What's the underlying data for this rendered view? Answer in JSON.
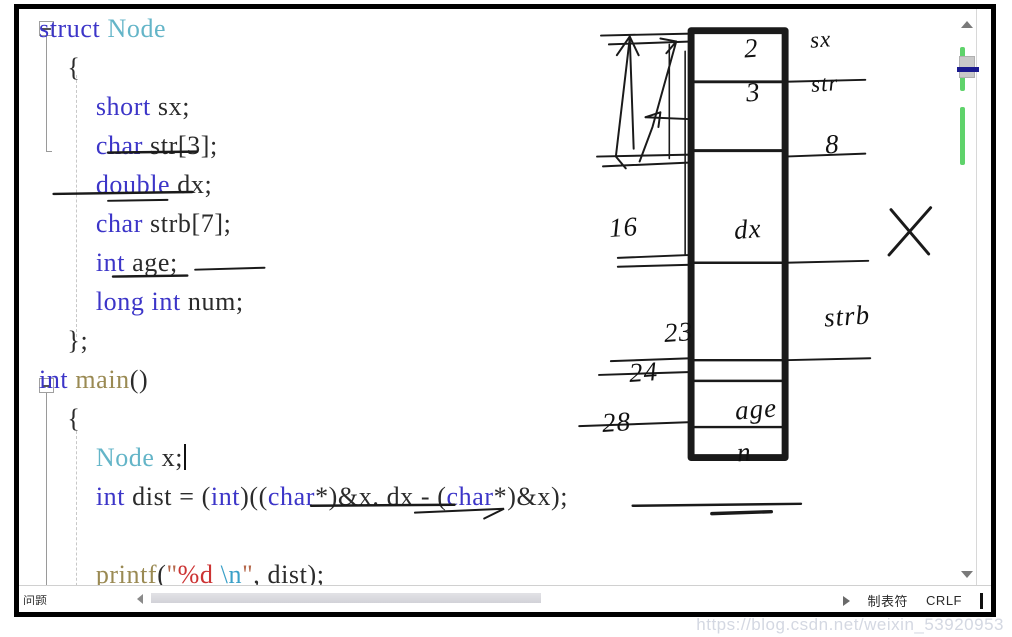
{
  "editor": {
    "language": "C++",
    "colors": {
      "keyword": "#3c35c8",
      "class": "#64b5c8",
      "function": "#9a8a53",
      "identifier": "#2b2b2b",
      "string": "#b5674a",
      "format_spec": "#cc3333",
      "escape": "#3aa0c8",
      "change_marker": "#5fd36b",
      "scroll_highlight": "#1b1b8f"
    },
    "code_lines": [
      {
        "id": "l1",
        "indent": 0,
        "fold": "open",
        "tokens": [
          {
            "t": "struct",
            "c": "kw"
          },
          {
            "t": " ",
            "c": "punc"
          },
          {
            "t": "Node",
            "c": "cls"
          }
        ]
      },
      {
        "id": "l2",
        "indent": 1,
        "tokens": [
          {
            "t": "{",
            "c": "punc"
          }
        ]
      },
      {
        "id": "l3",
        "indent": 2,
        "tokens": [
          {
            "t": "short",
            "c": "type"
          },
          {
            "t": " sx",
            "c": "id"
          },
          {
            "t": ";",
            "c": "punc"
          }
        ]
      },
      {
        "id": "l4",
        "indent": 2,
        "tokens": [
          {
            "t": "char",
            "c": "type"
          },
          {
            "t": " str",
            "c": "id"
          },
          {
            "t": "[",
            "c": "punc"
          },
          {
            "t": "3",
            "c": "num"
          },
          {
            "t": "]",
            "c": "punc"
          },
          {
            "t": ";",
            "c": "punc"
          }
        ]
      },
      {
        "id": "l5",
        "indent": 2,
        "tokens": [
          {
            "t": "double",
            "c": "type"
          },
          {
            "t": " dx",
            "c": "id"
          },
          {
            "t": ";",
            "c": "punc"
          }
        ]
      },
      {
        "id": "l6",
        "indent": 2,
        "tokens": [
          {
            "t": "char",
            "c": "type"
          },
          {
            "t": " strb",
            "c": "id"
          },
          {
            "t": "[",
            "c": "punc"
          },
          {
            "t": "7",
            "c": "num"
          },
          {
            "t": "]",
            "c": "punc"
          },
          {
            "t": ";",
            "c": "punc"
          }
        ]
      },
      {
        "id": "l7",
        "indent": 2,
        "tokens": [
          {
            "t": "int",
            "c": "type"
          },
          {
            "t": " age",
            "c": "id"
          },
          {
            "t": ";",
            "c": "punc"
          }
        ]
      },
      {
        "id": "l8",
        "indent": 2,
        "tokens": [
          {
            "t": "long",
            "c": "type"
          },
          {
            "t": " ",
            "c": "punc"
          },
          {
            "t": "int",
            "c": "type"
          },
          {
            "t": " num",
            "c": "id"
          },
          {
            "t": ";",
            "c": "punc"
          }
        ]
      },
      {
        "id": "l9",
        "indent": 1,
        "tokens": [
          {
            "t": "};",
            "c": "punc"
          }
        ]
      },
      {
        "id": "l10",
        "indent": 0,
        "fold": "open",
        "tokens": [
          {
            "t": "int",
            "c": "kw"
          },
          {
            "t": " ",
            "c": "punc"
          },
          {
            "t": "main",
            "c": "fn"
          },
          {
            "t": "()",
            "c": "punc"
          }
        ]
      },
      {
        "id": "l11",
        "indent": 1,
        "tokens": [
          {
            "t": "{",
            "c": "punc"
          }
        ]
      },
      {
        "id": "l12",
        "indent": 2,
        "caret": true,
        "tokens": [
          {
            "t": "Node",
            "c": "cls"
          },
          {
            "t": " x",
            "c": "id"
          },
          {
            "t": ";",
            "c": "punc"
          }
        ]
      },
      {
        "id": "l13",
        "indent": 2,
        "tokens": [
          {
            "t": "int",
            "c": "type"
          },
          {
            "t": " dist ",
            "c": "id"
          },
          {
            "t": "= ",
            "c": "punc"
          },
          {
            "t": "(",
            "c": "punc"
          },
          {
            "t": "int",
            "c": "type"
          },
          {
            "t": ")",
            "c": "punc"
          },
          {
            "t": "((",
            "c": "punc"
          },
          {
            "t": "char",
            "c": "type"
          },
          {
            "t": "*)",
            "c": "punc"
          },
          {
            "t": "&x",
            "c": "id"
          },
          {
            "t": ". ",
            "c": "punc"
          },
          {
            "t": "dx ",
            "c": "id"
          },
          {
            "t": "- ",
            "c": "punc"
          },
          {
            "t": "(",
            "c": "punc"
          },
          {
            "t": "char",
            "c": "type"
          },
          {
            "t": "*)",
            "c": "punc"
          },
          {
            "t": "&x",
            "c": "id"
          },
          {
            "t": ");",
            "c": "punc"
          }
        ]
      },
      {
        "id": "l14",
        "indent": 2,
        "tokens": []
      },
      {
        "id": "l15",
        "indent": 2,
        "tokens": [
          {
            "t": "printf",
            "c": "fn"
          },
          {
            "t": "(",
            "c": "punc"
          },
          {
            "t": "\"",
            "c": "str"
          },
          {
            "t": "%d",
            "c": "fmt"
          },
          {
            "t": " ",
            "c": "str"
          },
          {
            "t": "\\n",
            "c": "esc"
          },
          {
            "t": "\"",
            "c": "str"
          },
          {
            "t": ", ",
            "c": "punc"
          },
          {
            "t": "dist",
            "c": "id"
          },
          {
            "t": ");",
            "c": "punc"
          }
        ]
      }
    ]
  },
  "annotations": {
    "title": "handwritten struct memory layout",
    "box_cells": [
      {
        "name": "sx-cell",
        "inside": "2",
        "right_label": "sx"
      },
      {
        "name": "str-cell",
        "inside": "3",
        "right_label": "str"
      },
      {
        "name": "dx-cell",
        "inside": "dx",
        "right_label": "8"
      },
      {
        "name": "strb-cell",
        "inside": "",
        "right_label": "strb"
      },
      {
        "name": "age-cell",
        "inside": "age",
        "right_label": ""
      },
      {
        "name": "num-cell",
        "inside": "n",
        "right_label": ""
      }
    ],
    "left_offsets": [
      "16",
      "23",
      "24",
      "28"
    ],
    "cross_mark": "X"
  },
  "statusbar": {
    "left_label": "问题",
    "indent_label": "制表符",
    "eol_label": "CRLF"
  },
  "watermark": {
    "text": "https://blog.csdn.net/weixin_53920953"
  }
}
